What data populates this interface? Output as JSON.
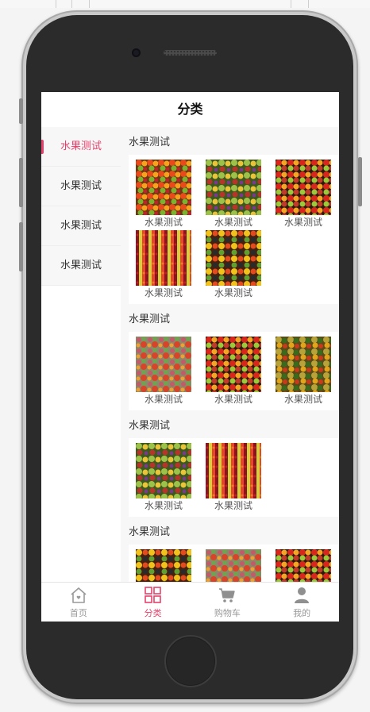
{
  "header": {
    "title": "分类"
  },
  "sidebar": {
    "items": [
      {
        "label": "水果测试",
        "active": true
      },
      {
        "label": "水果测试",
        "active": false
      },
      {
        "label": "水果测试",
        "active": false
      },
      {
        "label": "水果测试",
        "active": false
      }
    ]
  },
  "sections": [
    {
      "title": "水果测试",
      "items": [
        {
          "label": "水果测试"
        },
        {
          "label": "水果测试"
        },
        {
          "label": "水果测试"
        },
        {
          "label": "水果测试"
        },
        {
          "label": "水果测试"
        }
      ]
    },
    {
      "title": "水果测试",
      "items": [
        {
          "label": "水果测试"
        },
        {
          "label": "水果测试"
        },
        {
          "label": "水果测试"
        }
      ]
    },
    {
      "title": "水果测试",
      "items": [
        {
          "label": "水果测试"
        },
        {
          "label": "水果测试"
        }
      ]
    },
    {
      "title": "水果测试",
      "items": []
    }
  ],
  "tabbar": {
    "items": [
      {
        "label": "首页",
        "icon": "home-icon",
        "active": false
      },
      {
        "label": "分类",
        "icon": "category-grid-icon",
        "active": true
      },
      {
        "label": "购物车",
        "icon": "cart-icon",
        "active": false
      },
      {
        "label": "我的",
        "icon": "user-icon",
        "active": false
      }
    ]
  },
  "colors": {
    "accent": "#e5426b",
    "inactive": "#999999"
  }
}
